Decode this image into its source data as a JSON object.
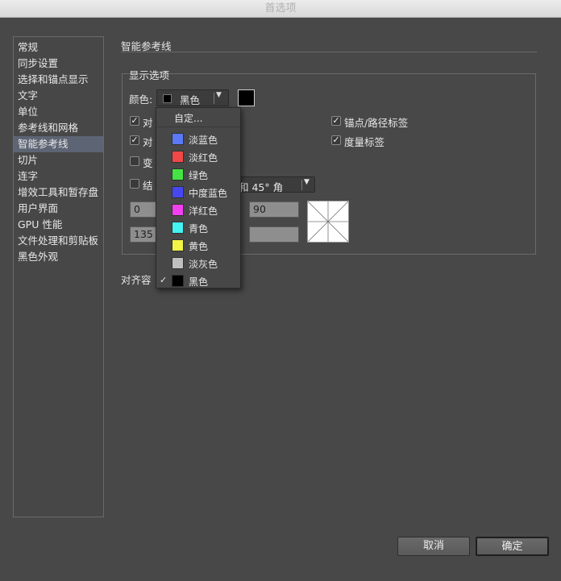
{
  "window": {
    "title": "首选项"
  },
  "sidebar": {
    "items": [
      {
        "label": "常规",
        "selected": false
      },
      {
        "label": "同步设置",
        "selected": false
      },
      {
        "label": "选择和锚点显示",
        "selected": false
      },
      {
        "label": "文字",
        "selected": false
      },
      {
        "label": "单位",
        "selected": false
      },
      {
        "label": "参考线和网格",
        "selected": false
      },
      {
        "label": "智能参考线",
        "selected": true
      },
      {
        "label": "切片",
        "selected": false
      },
      {
        "label": "连字",
        "selected": false
      },
      {
        "label": "增效工具和暂存盘",
        "selected": false
      },
      {
        "label": "用户界面",
        "selected": false
      },
      {
        "label": "GPU 性能",
        "selected": false
      },
      {
        "label": "文件处理和剪贴板",
        "selected": false
      },
      {
        "label": "黑色外观",
        "selected": false
      }
    ]
  },
  "main": {
    "section_title": "智能参考线",
    "display_options": {
      "title": "显示选项",
      "color_label": "颜色:",
      "color_value": "黑色",
      "color_swatch": "#000000",
      "checkboxes": [
        {
          "label": "对",
          "checked": true
        },
        {
          "label": "对",
          "checked": true
        },
        {
          "label": "变",
          "checked": false
        },
        {
          "label": "结",
          "checked": false
        },
        {
          "label": "锚点/路径标签",
          "checked": true
        },
        {
          "label": "度量标签",
          "checked": true
        }
      ],
      "angle_select_value": "和 45° 角",
      "angle_fields": [
        "0",
        "90",
        "135",
        ""
      ]
    },
    "snap_label": "对齐容"
  },
  "dropdown": {
    "custom_label": "自定...",
    "items": [
      {
        "label": "淡蓝色",
        "color": "#5b78f5",
        "checked": false
      },
      {
        "label": "淡红色",
        "color": "#f04848",
        "checked": false
      },
      {
        "label": "绿色",
        "color": "#43e443",
        "checked": false
      },
      {
        "label": "中度蓝色",
        "color": "#4747f2",
        "checked": false
      },
      {
        "label": "洋红色",
        "color": "#f040f0",
        "checked": false
      },
      {
        "label": "青色",
        "color": "#45f3f3",
        "checked": false
      },
      {
        "label": "黄色",
        "color": "#f4f446",
        "checked": false
      },
      {
        "label": "淡灰色",
        "color": "#bfbfbf",
        "checked": false
      },
      {
        "label": "黑色",
        "color": "#000000",
        "checked": true
      }
    ],
    "check_glyph": "✓"
  },
  "buttons": {
    "cancel": "取消",
    "ok": "确定"
  }
}
